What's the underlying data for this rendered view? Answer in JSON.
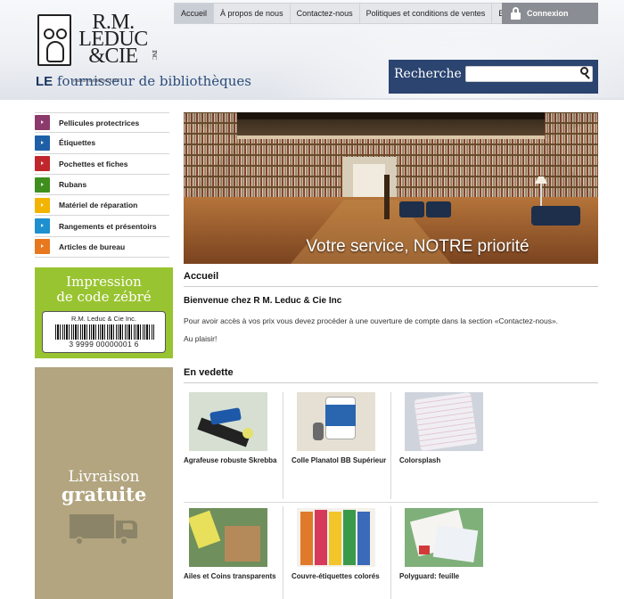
{
  "brand": {
    "logo_line1": "R.M.",
    "logo_line2": "LEDUC",
    "logo_line3": "&CIE",
    "logo_inc": "INC",
    "logo_sub": "maison   fondée en 1962",
    "tagline_strong": "LE",
    "tagline_rest": " fournisseur de bibliothèques"
  },
  "topnav": {
    "items": [
      "Accueil",
      "À propos de nous",
      "Contactez-nous",
      "Politiques et conditions de ventes",
      "English"
    ],
    "login": "Connexion"
  },
  "search": {
    "label": "Recherche",
    "placeholder": ""
  },
  "sidebar": {
    "categories": [
      {
        "label": "Pellicules protectrices",
        "color": "#8b3a6b"
      },
      {
        "label": "Étiquettes",
        "color": "#1f5fa8"
      },
      {
        "label": "Pochettes et fiches",
        "color": "#c0272d"
      },
      {
        "label": "Rubans",
        "color": "#3f8f1f"
      },
      {
        "label": "Matériel de réparation",
        "color": "#f2b400"
      },
      {
        "label": "Rangements et présentoirs",
        "color": "#1e8fcf"
      },
      {
        "label": "Articles de bureau",
        "color": "#e8781e"
      }
    ]
  },
  "promo_barcode": {
    "line1": "Impression",
    "line2": "de code zébré",
    "company": "R.M. Leduc & Cie Inc.",
    "number": "3 9999 00000001 6"
  },
  "promo_shipping": {
    "line1": "Livraison",
    "line2": "gratuite"
  },
  "hero": {
    "caption": "Votre service, NOTRE priorité"
  },
  "main": {
    "title": "Accueil",
    "welcome": "Bienvenue chez R M. Leduc & Cie Inc",
    "paragraph": "Pour avoir accès à vos prix vous devez procéder à une ouverture de compte dans la section «Contactez-nous».",
    "closing": "Au plaisir!"
  },
  "featured": {
    "title": "En vedette",
    "products": [
      {
        "name": "Agrafeuse robuste Skrebba"
      },
      {
        "name": "Colle Planatol BB Supérieur"
      },
      {
        "name": "Colorsplash"
      },
      {
        "name": "Ailes et Coins transparents"
      },
      {
        "name": "Couvre-étiquettes colorés"
      },
      {
        "name": "Polyguard: feuille"
      }
    ]
  }
}
